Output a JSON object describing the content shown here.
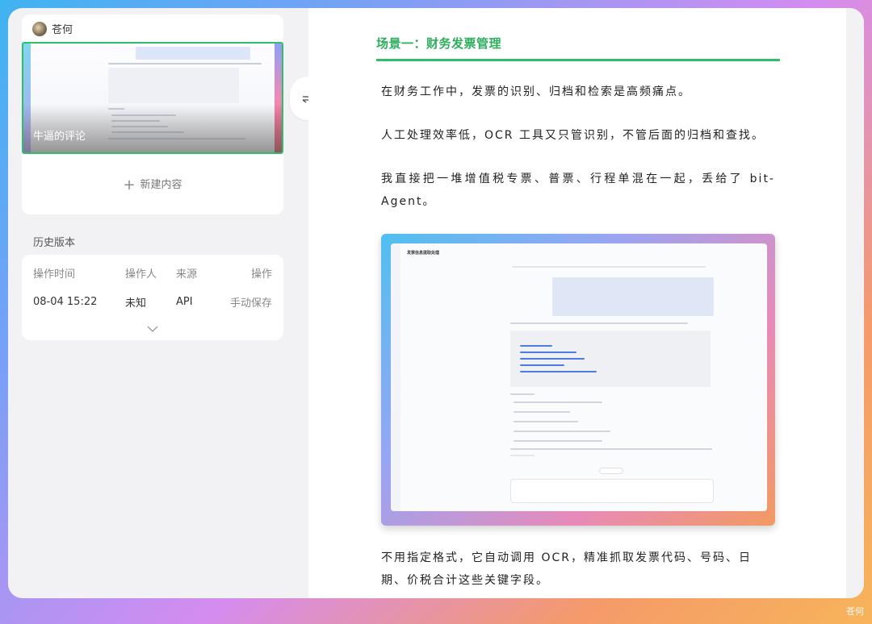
{
  "left_panel": {
    "author": {
      "name": "苍何"
    },
    "thumbnail": {
      "caption": "牛逼的评论"
    },
    "new_content_label": "新建内容",
    "history": {
      "title": "历史版本",
      "columns": [
        "操作时间",
        "操作人",
        "来源",
        "操作"
      ],
      "rows": [
        {
          "time": "08-04 15:22",
          "operator": "未知",
          "source": "API",
          "action": "手动保存"
        }
      ]
    }
  },
  "icons": {
    "swap": "swap-arrows-icon",
    "plus": "plus-icon",
    "expand": "chevron-down-icon"
  },
  "article": {
    "section_title": "场景一：财务发票管理",
    "paragraphs": [
      "在财务工作中，发票的识别、归档和检索是高频痛点。",
      "人工处理效率低，OCR 工具又只管识别，不管后面的归档和查找。",
      "我直接把一堆增值税专票、普票、行程单混在一起，丢给了 bit-Agent。",
      "不用指定格式，它自动调用 OCR，精准抓取发票代码、号码、日期、价税合计这些关键字段。"
    ],
    "screenshot": {
      "title": "发票信息提取处理"
    }
  },
  "watermark": "苍何",
  "colors": {
    "accent_green": "#2fbf6a",
    "title_green": "#2fae5e"
  }
}
